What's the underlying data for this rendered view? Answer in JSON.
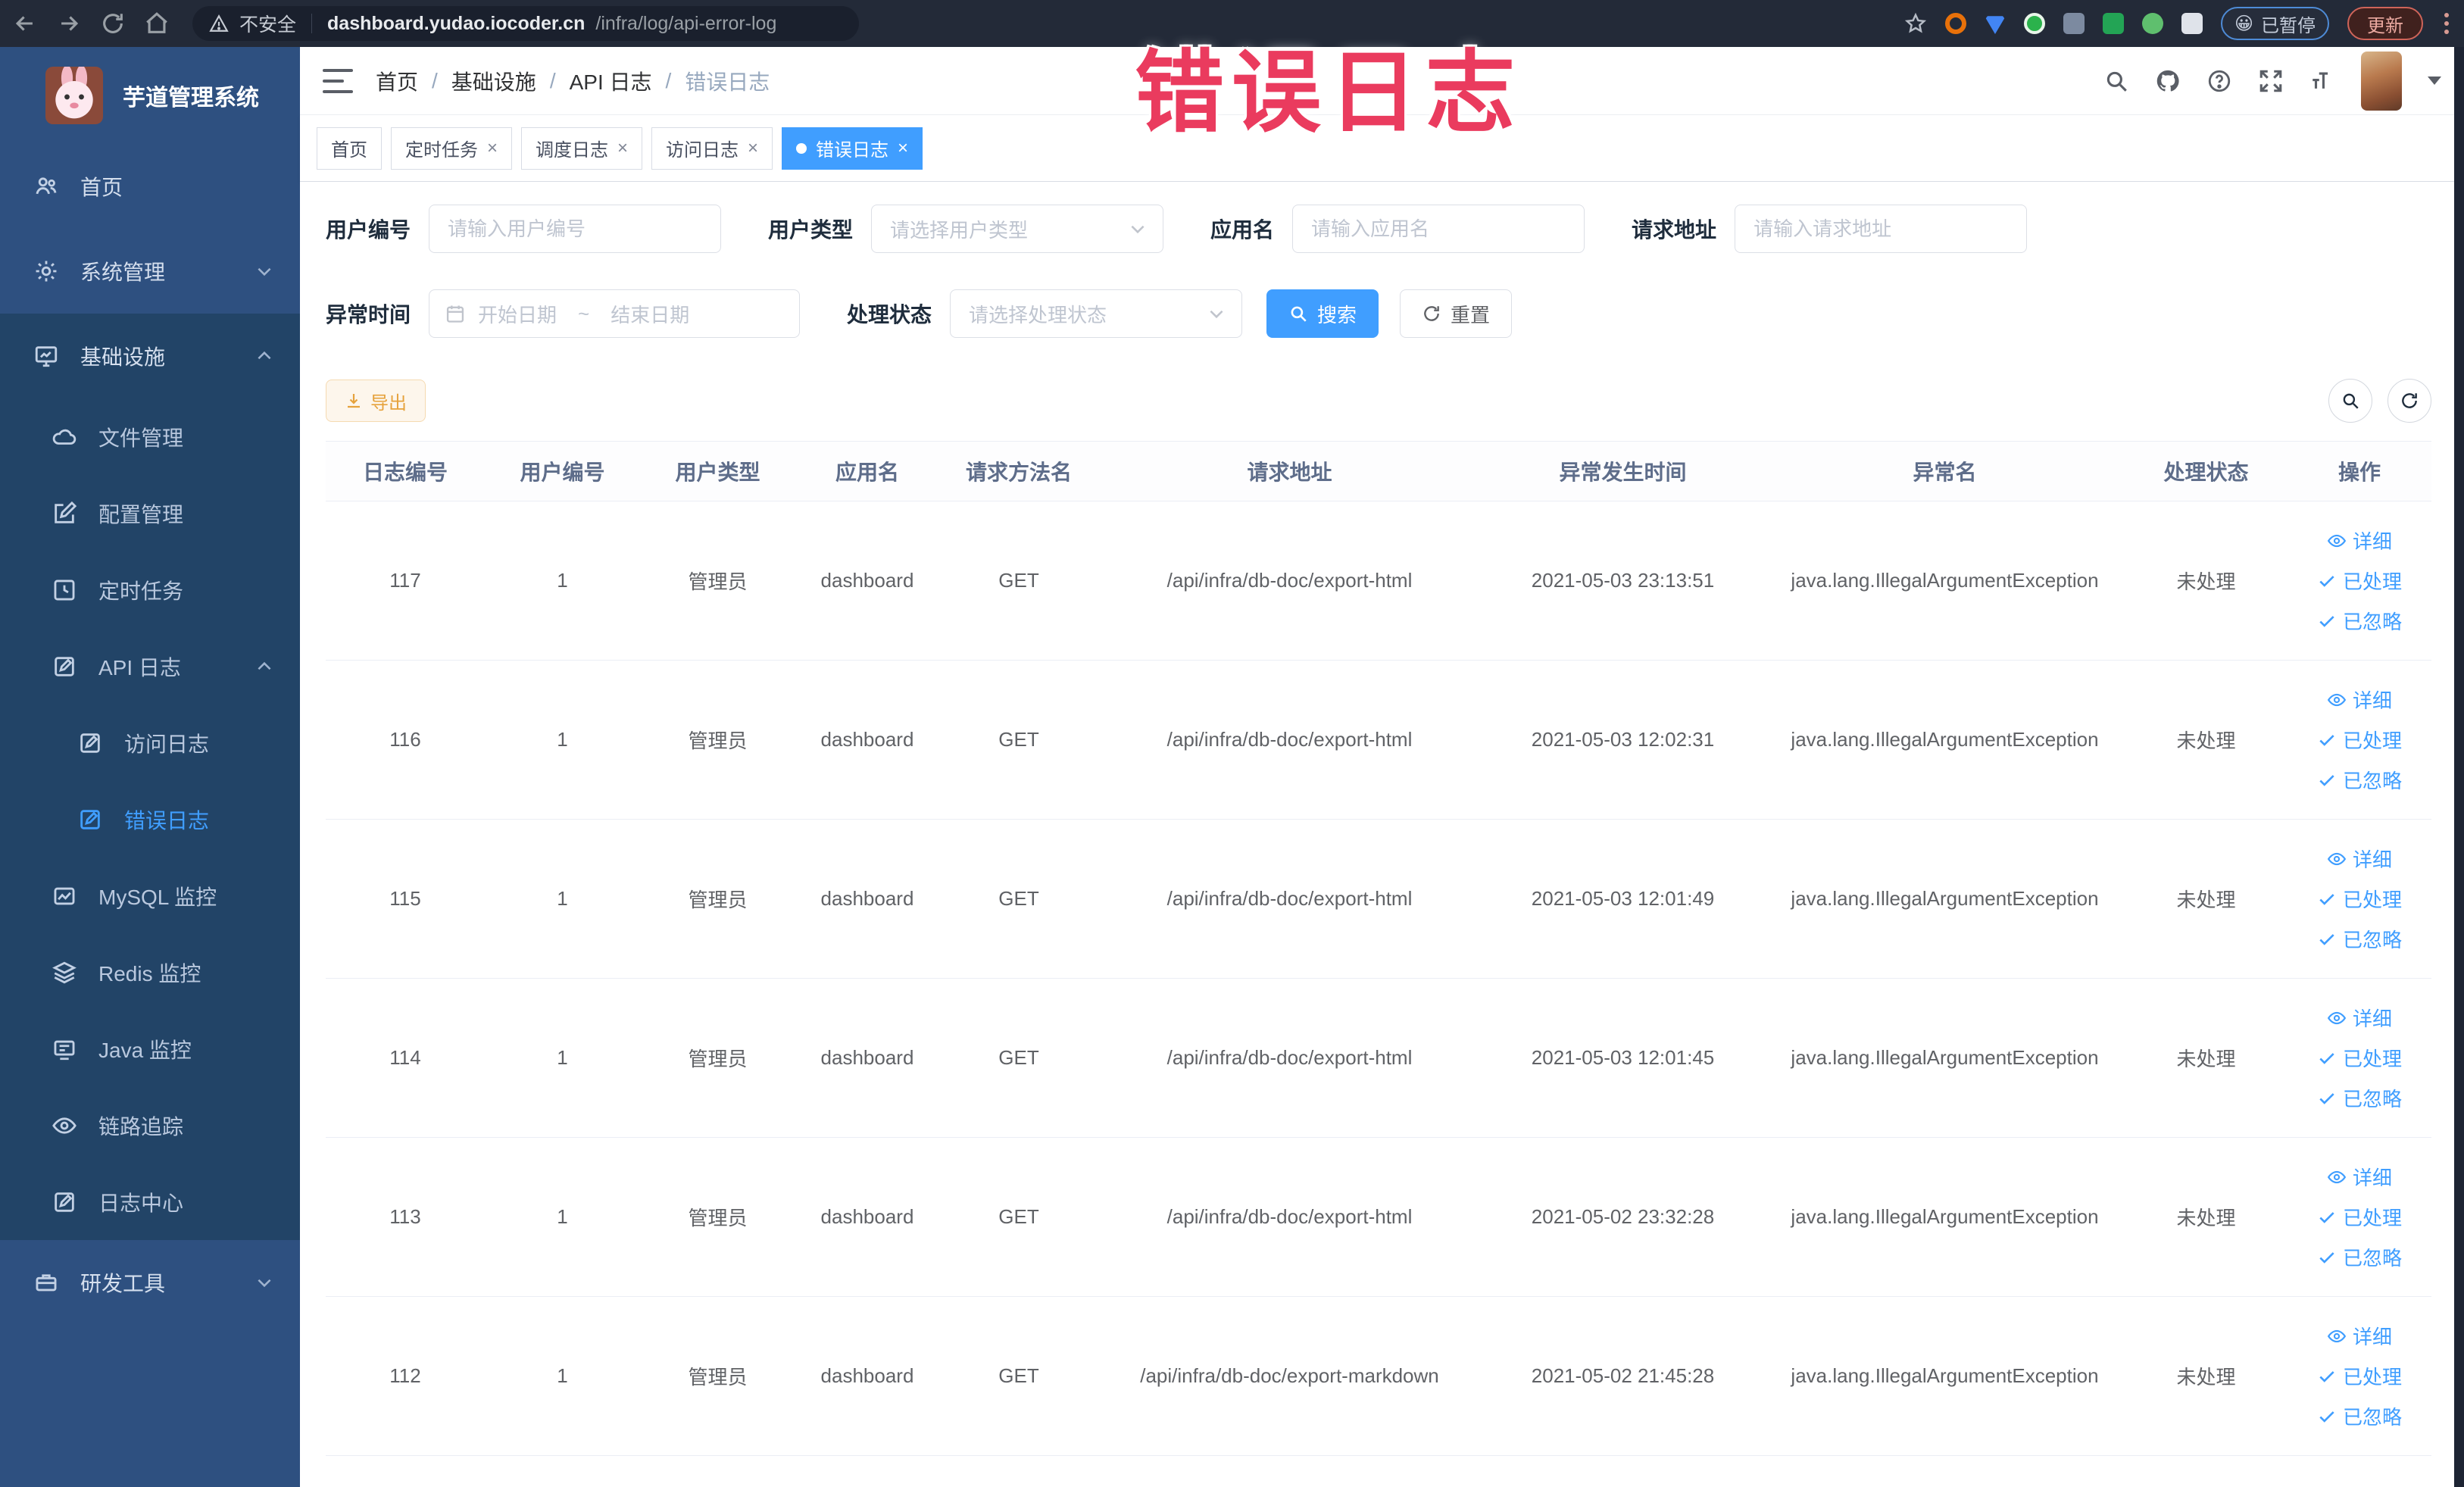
{
  "browser": {
    "security_label": "不安全",
    "url_host": "dashboard.yudao.iocoder.cn",
    "url_path": "/infra/log/api-error-log",
    "paused_emoji": "😀",
    "paused_badge": "已暂停",
    "update_badge": "更新"
  },
  "annotation": {
    "text": "错误日志",
    "color": "#ea3b5e"
  },
  "sidebar": {
    "logo_title": "芋道管理系统",
    "items": {
      "home": "首页",
      "system": "系统管理",
      "infra": "基础设施",
      "file": "文件管理",
      "config": "配置管理",
      "job": "定时任务",
      "api_log": "API 日志",
      "access_log": "访问日志",
      "error_log": "错误日志",
      "mysql": "MySQL 监控",
      "redis": "Redis 监控",
      "java": "Java 监控",
      "trace": "链路追踪",
      "log_center": "日志中心",
      "dev_tools": "研发工具"
    }
  },
  "breadcrumb": {
    "separator": "/",
    "items": [
      "首页",
      "基础设施",
      "API 日志",
      "错误日志"
    ]
  },
  "tabs": [
    {
      "label": "首页"
    },
    {
      "label": "定时任务"
    },
    {
      "label": "调度日志"
    },
    {
      "label": "访问日志"
    },
    {
      "label": "错误日志"
    }
  ],
  "filters": {
    "user_id_label": "用户编号",
    "user_id_placeholder": "请输入用户编号",
    "user_type_label": "用户类型",
    "user_type_placeholder": "请选择用户类型",
    "app_name_label": "应用名",
    "app_name_placeholder": "请输入应用名",
    "request_url_label": "请求地址",
    "request_url_placeholder": "请输入请求地址",
    "exception_time_label": "异常时间",
    "date_start_placeholder": "开始日期",
    "date_separator": "~",
    "date_end_placeholder": "结束日期",
    "process_status_label": "处理状态",
    "process_status_placeholder": "请选择处理状态",
    "search_label": "搜索",
    "reset_label": "重置"
  },
  "toolbar": {
    "export_label": "导出"
  },
  "table": {
    "columns": [
      "日志编号",
      "用户编号",
      "用户类型",
      "应用名",
      "请求方法名",
      "请求地址",
      "异常发生时间",
      "异常名",
      "处理状态",
      "操作"
    ],
    "actions": [
      "详细",
      "已处理",
      "已忽略"
    ],
    "rows": [
      [
        "117",
        "1",
        "管理员",
        "dashboard",
        "GET",
        "/api/infra/db-doc/export-html",
        "2021-05-03 23:13:51",
        "java.lang.IllegalArgumentException",
        "未处理"
      ],
      [
        "116",
        "1",
        "管理员",
        "dashboard",
        "GET",
        "/api/infra/db-doc/export-html",
        "2021-05-03 12:02:31",
        "java.lang.IllegalArgumentException",
        "未处理"
      ],
      [
        "115",
        "1",
        "管理员",
        "dashboard",
        "GET",
        "/api/infra/db-doc/export-html",
        "2021-05-03 12:01:49",
        "java.lang.IllegalArgumentException",
        "未处理"
      ],
      [
        "114",
        "1",
        "管理员",
        "dashboard",
        "GET",
        "/api/infra/db-doc/export-html",
        "2021-05-03 12:01:45",
        "java.lang.IllegalArgumentException",
        "未处理"
      ],
      [
        "113",
        "1",
        "管理员",
        "dashboard",
        "GET",
        "/api/infra/db-doc/export-html",
        "2021-05-02 23:32:28",
        "java.lang.IllegalArgumentException",
        "未处理"
      ],
      [
        "112",
        "1",
        "管理员",
        "dashboard",
        "GET",
        "/api/infra/db-doc/export-markdown",
        "2021-05-02 21:45:28",
        "java.lang.IllegalArgumentException",
        "未处理"
      ]
    ]
  },
  "colors": {
    "accent": "#409eff",
    "warning": "#e6a23c",
    "sidebar": "#2e5080",
    "sidebar_dark": "#224467"
  }
}
